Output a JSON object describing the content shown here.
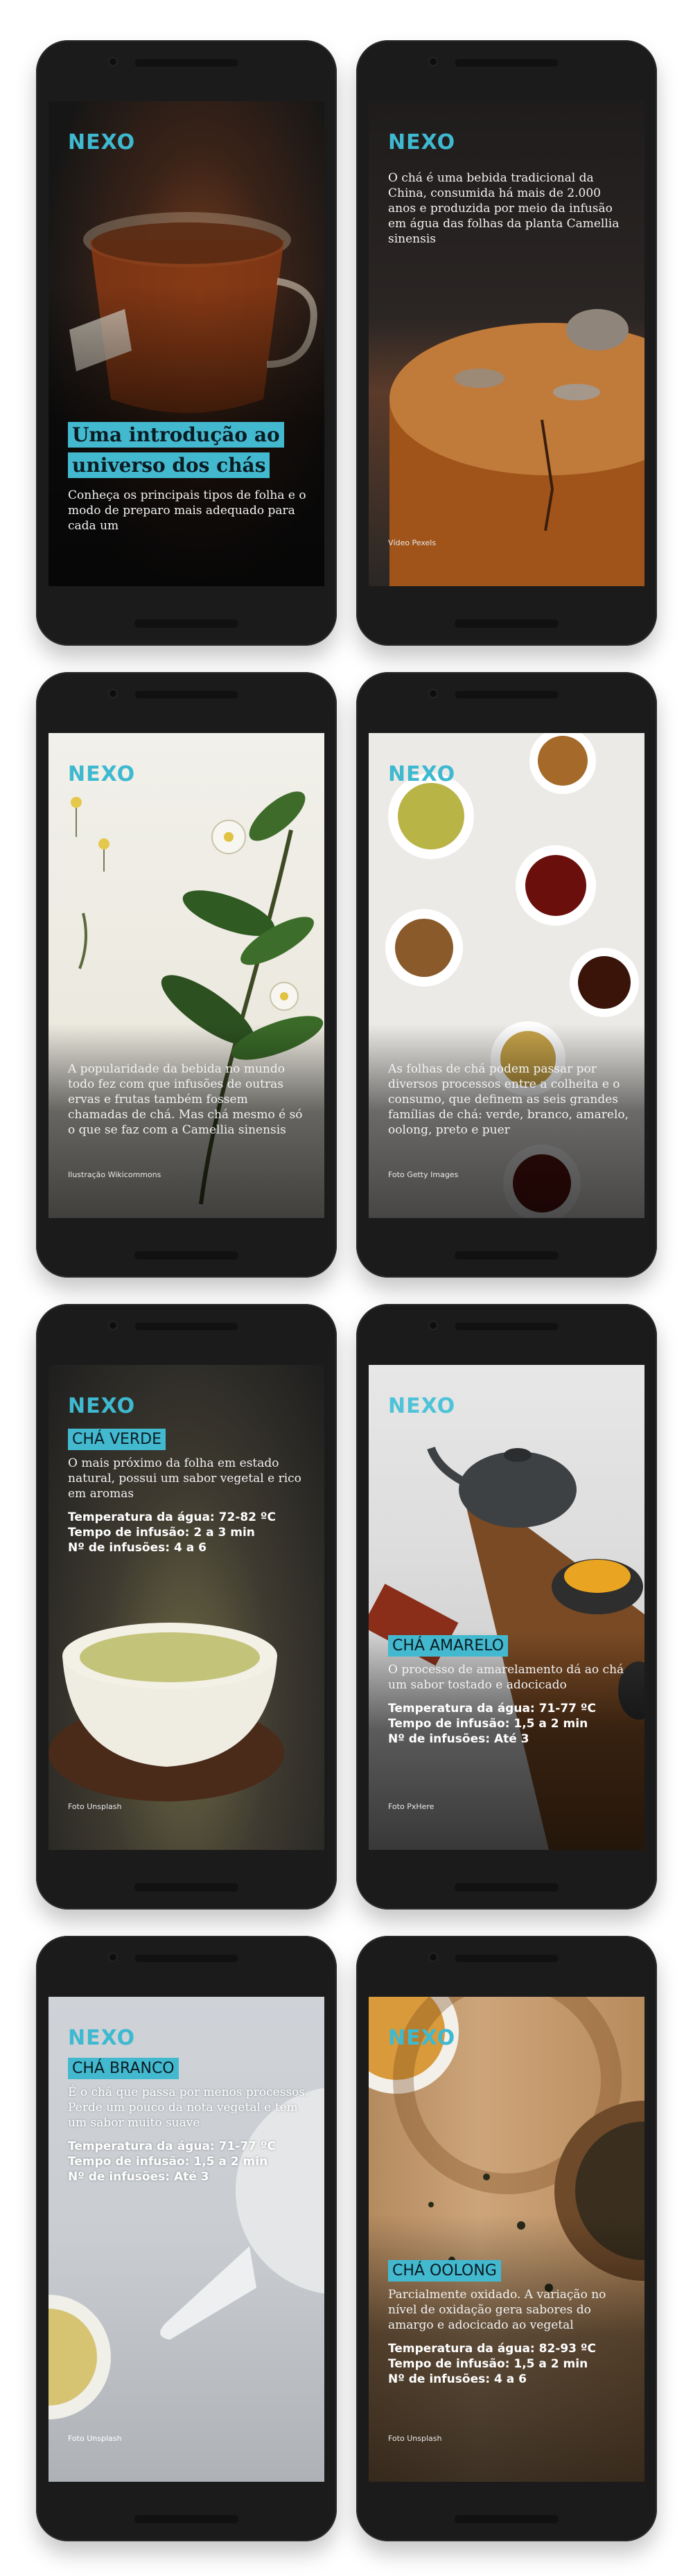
{
  "brand": {
    "logo": "NEXO",
    "accent": "#43b9cf"
  },
  "slides": [
    {
      "headline": "Uma introdução ao universo dos chás",
      "text": "Conheça os principais tipos de folha e o modo de preparo mais adequado para cada um",
      "credit": ""
    },
    {
      "text": "O chá é uma bebida tradicional da China, consumida há mais de 2.000 anos e produzida por meio da infusão em água das folhas da planta Camellia sinensis",
      "credit": "Vídeo Pexels"
    },
    {
      "text": "A popularidade da bebida no mundo todo fez com que infusões de outras ervas e frutas também fossem chamadas de chá. Mas chá mesmo é só o que se faz com a Camellia sinensis",
      "credit": "Ilustração Wikicommons"
    },
    {
      "text": "As folhas de chá podem passar por diversos processos entre a colheita e o consumo, que definem as seis grandes famílias de chá: verde, branco, amarelo, oolong, preto e puer",
      "credit": "Foto Getty Images"
    },
    {
      "tag": "CHÁ VERDE",
      "text": "O mais próximo da folha em estado natural, possui um sabor vegetal e rico em aromas",
      "temp": "Temperatura da água: 72-82 ºC",
      "time": "Tempo de infusão: 2 a 3 min",
      "count": "Nº de infusões: 4 a 6",
      "credit": "Foto Unsplash"
    },
    {
      "tag": "CHÁ AMARELO",
      "text": "O processo de amarelamento dá ao chá um sabor tostado e adocicado",
      "temp": "Temperatura da água: 71-77 ºC",
      "time": "Tempo de infusão: 1,5 a 2 min",
      "count": "Nº de infusões: Até 3",
      "credit": "Foto PxHere"
    },
    {
      "tag": "CHÁ BRANCO",
      "text": "É o chá que passa por menos processos. Perde um pouco da nota vegetal e tem um sabor muito suave",
      "temp": "Temperatura da água: 71-77 ºC",
      "time": "Tempo de infusão: 1,5 a 2 min",
      "count": "Nº de infusões: Até 3",
      "credit": "Foto Unsplash"
    },
    {
      "tag": "CHÁ OOLONG",
      "text": "Parcialmente oxidado. A variação no nível de oxidação gera sabores do amargo e adocicado ao vegetal",
      "temp": "Temperatura da água: 82-93 ºC",
      "time": "Tempo de infusão: 1,5 a 2 min",
      "count": "Nº de infusões: 4 a 6",
      "credit": "Foto Unsplash"
    }
  ]
}
